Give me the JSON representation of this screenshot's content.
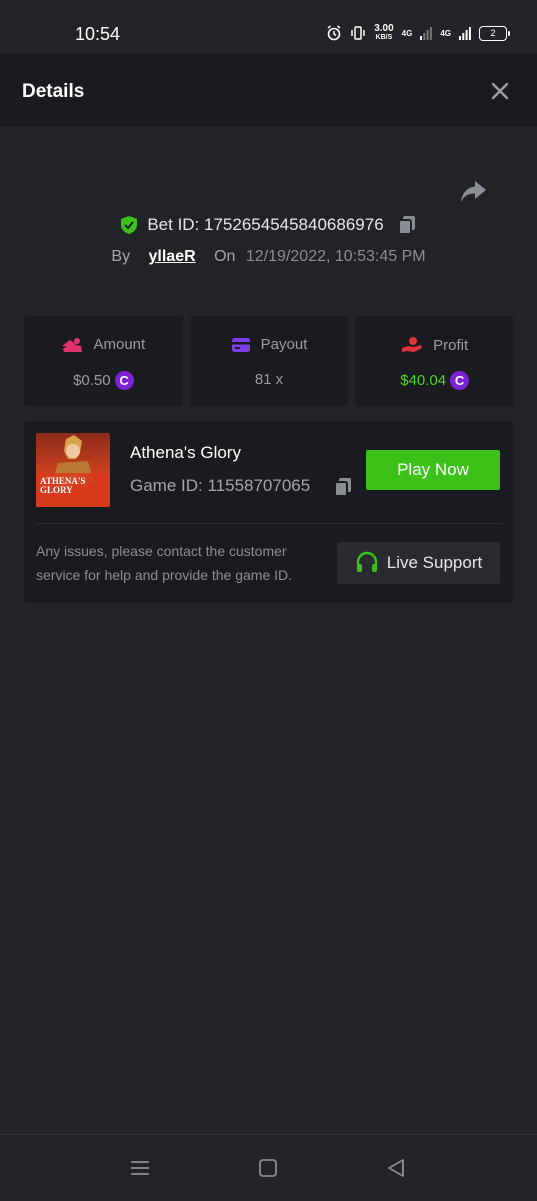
{
  "status_bar": {
    "time": "10:54",
    "net_speed_value": "3.00",
    "net_speed_unit": "KB/S",
    "net_type_1": "4G",
    "net_type_2": "4G",
    "battery": "2"
  },
  "header": {
    "title": "Details"
  },
  "bet": {
    "id_label": "Bet ID: 1752654545840686976",
    "by_label": "By",
    "user": "yllaeR",
    "on_label": "On",
    "datetime": "12/19/2022, 10:53:45 PM"
  },
  "stats": {
    "amount": {
      "label": "Amount",
      "value": "$0.50",
      "icon": "amount-icon",
      "color": "#e0336f"
    },
    "payout": {
      "label": "Payout",
      "value": "81 x",
      "icon": "wallet-icon",
      "color": "#7b3fe4"
    },
    "profit": {
      "label": "Profit",
      "value": "$40.04",
      "icon": "profit-hand-icon",
      "color": "#e0333a",
      "value_color": "#4dd62a"
    }
  },
  "coin_symbol": "C",
  "game": {
    "thumb_text": "ATHENA'S GLORY",
    "name": "Athena's Glory",
    "id_label": "Game ID: 11558707065",
    "play_label": "Play Now",
    "help_text": "Any issues, please contact the customer service for help and provide the game ID.",
    "support_label": "Live Support"
  },
  "colors": {
    "accent_green": "#3bc117",
    "shield_green": "#3bc117",
    "background": "#222326",
    "card": "#1a1b1e"
  }
}
